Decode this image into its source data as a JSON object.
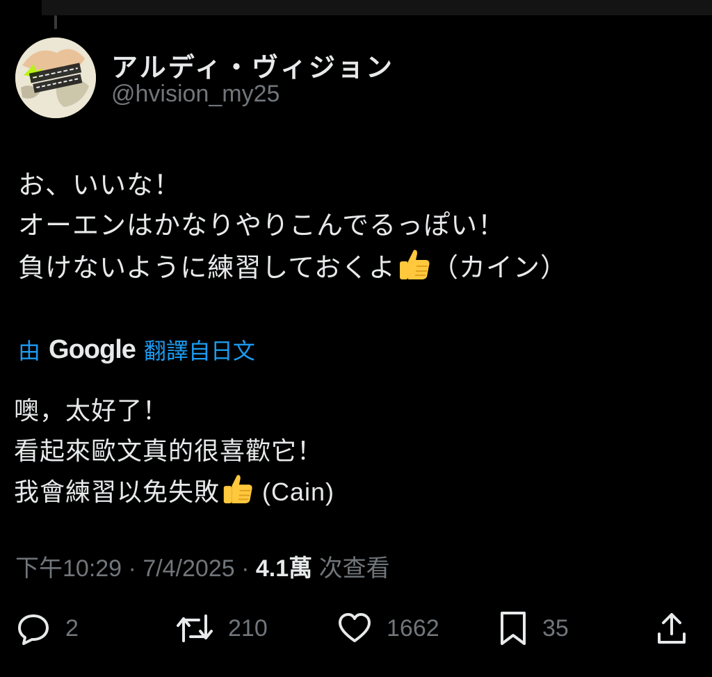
{
  "author": {
    "display_name": "アルディ・ヴィジョン",
    "handle": "@hvision_my25"
  },
  "post": {
    "original_lines": [
      "お、いいな！",
      "オーエンはかなりやりこんでるっぽい！",
      "負けないように練習しておくよ"
    ],
    "original_suffix": "（カイン）",
    "translation": {
      "by": "由",
      "engine": "Google",
      "from": "翻譯自日文"
    },
    "translated_lines": [
      "噢，太好了！",
      "看起來歐文真的很喜歡它！",
      "我會練習以免失敗"
    ],
    "translated_suffix": " (Cain)",
    "emoji": "thumbs-up"
  },
  "meta": {
    "time": "下午10:29",
    "sep": " · ",
    "date": "7/4/2025",
    "views_count": "4.1萬",
    "views_label": " 次查看"
  },
  "actions": {
    "replies": "2",
    "reposts": "210",
    "likes": "1662",
    "bookmarks": "35"
  },
  "colors": {
    "background": "#000000",
    "text": "#e7e9ea",
    "secondary": "#71767b",
    "link": "#1d9bf0"
  }
}
